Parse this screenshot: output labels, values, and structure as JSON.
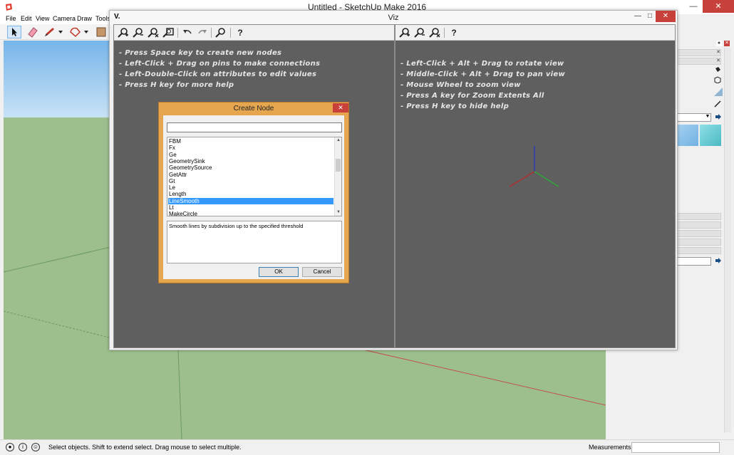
{
  "app": {
    "title": "Untitled - SketchUp Make 2016",
    "menu": [
      "File",
      "Edit",
      "View",
      "Camera",
      "Draw",
      "Tools"
    ]
  },
  "viz": {
    "title": "Viz",
    "logo": "V.",
    "left_help": [
      "- Press Space key to create new nodes",
      "- Left-Click + Drag on pins to make connections",
      "- Left-Double-Click on attributes to edit values",
      "- Press H key for more help"
    ],
    "right_help": [
      "- Left-Click + Alt + Drag to rotate view",
      "- Middle-Click + Alt + Drag to pan view",
      "- Mouse Wheel to zoom view",
      "- Press A key for Zoom Extents All",
      "- Press H key to hide help"
    ],
    "help_tool_label": "?"
  },
  "dialog": {
    "title": "Create Node",
    "search_value": "",
    "items": [
      "FBM",
      "Fx",
      "Ge",
      "GeometrySink",
      "GeometrySource",
      "GetAttr",
      "Gt",
      "Le",
      "Length",
      "LineSmooth",
      "Lt",
      "MakeCircle"
    ],
    "selected_index": 9,
    "description": "Smooth lines by subdivision up to the specified threshold",
    "ok_label": "OK",
    "cancel_label": "Cancel"
  },
  "status": {
    "text": "Select objects. Shift to extend select. Drag mouse to select multiple.",
    "measurements_label": "Measurements",
    "measurements_value": ""
  },
  "colors": {
    "viz_pane_bg": "#5f5f5f",
    "dialog_frame": "#e5a64f",
    "selection": "#3399ff",
    "ground": "#9cbf8d",
    "sky": "#76b5ea",
    "close_red": "#c7403a"
  }
}
